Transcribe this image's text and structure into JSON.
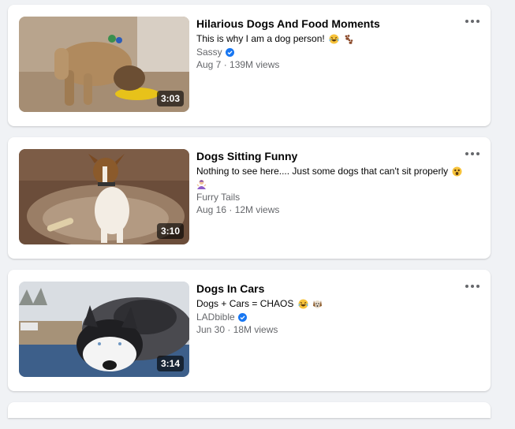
{
  "videos": [
    {
      "title": "Hilarious Dogs And Food Moments",
      "description": "This is why I am a dog person!",
      "description_emojis": [
        "laughing-emoji",
        "paw-prints-emoji"
      ],
      "channel": "Sassy",
      "verified": true,
      "date": "Aug 7",
      "views": "139M views",
      "meta": "Aug 7 · 139M views",
      "duration": "3:03"
    },
    {
      "title": "Dogs Sitting Funny",
      "description": "Nothing to see here.... Just some dogs that can't sit properly",
      "description_emojis": [
        "astonished-emoji",
        "person-shrugging-emoji"
      ],
      "channel": "Furry Tails",
      "verified": false,
      "date": "Aug 16",
      "views": "12M views",
      "meta": "Aug 16 · 12M views",
      "duration": "3:10"
    },
    {
      "title": "Dogs In Cars",
      "description": "Dogs + Cars = CHAOS",
      "description_emojis": [
        "laughing-emoji",
        "dog-face-emoji"
      ],
      "channel": "LADbible",
      "verified": true,
      "date": "Jun 30",
      "views": "18M views",
      "meta": "Jun 30 · 18M views",
      "duration": "3:14"
    }
  ],
  "colors": {
    "background": "#f0f2f5",
    "card": "#ffffff",
    "primary_text": "#050505",
    "secondary_text": "#65676b",
    "verified_blue": "#1877f2"
  }
}
